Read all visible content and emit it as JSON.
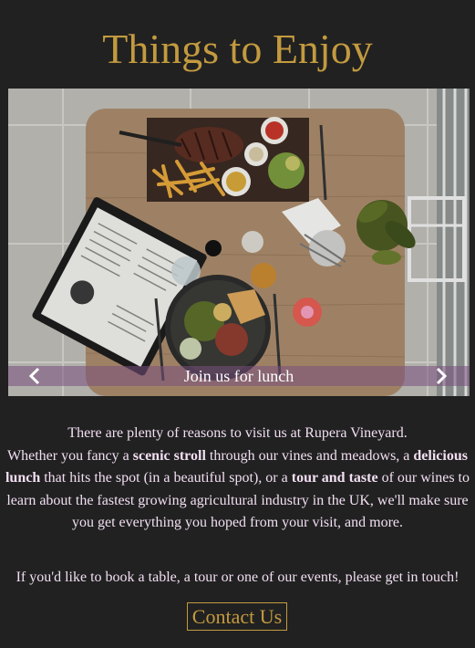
{
  "section": {
    "title": "Things to Enjoy"
  },
  "carousel": {
    "caption": "Join us for lunch",
    "prev_icon": "chevron-left-icon",
    "next_icon": "chevron-right-icon"
  },
  "intro": {
    "line1": "There are plenty of reasons to visit us at Rupera Vineyard.",
    "p1": "Whether you fancy a ",
    "b1": "scenic stroll",
    "p2": " through our vines and meadows, a ",
    "b2": "delicious lunch",
    "p3": " that hits the spot (in a beautiful spot), or a ",
    "b3": "tour and taste",
    "p4": " of our wines to learn about the fastest growing agricultural industry in the UK, we'll make sure you get everything you hoped from your visit, and more."
  },
  "cta": {
    "text": "If you'd like to book a table, a tour or one of our events, please get in touch!",
    "button_label": "Contact Us"
  },
  "colors": {
    "background": "#212121",
    "accent_gold": "#c39a3f",
    "body_text": "#f2dff2",
    "caption_bar": "#78507d"
  }
}
